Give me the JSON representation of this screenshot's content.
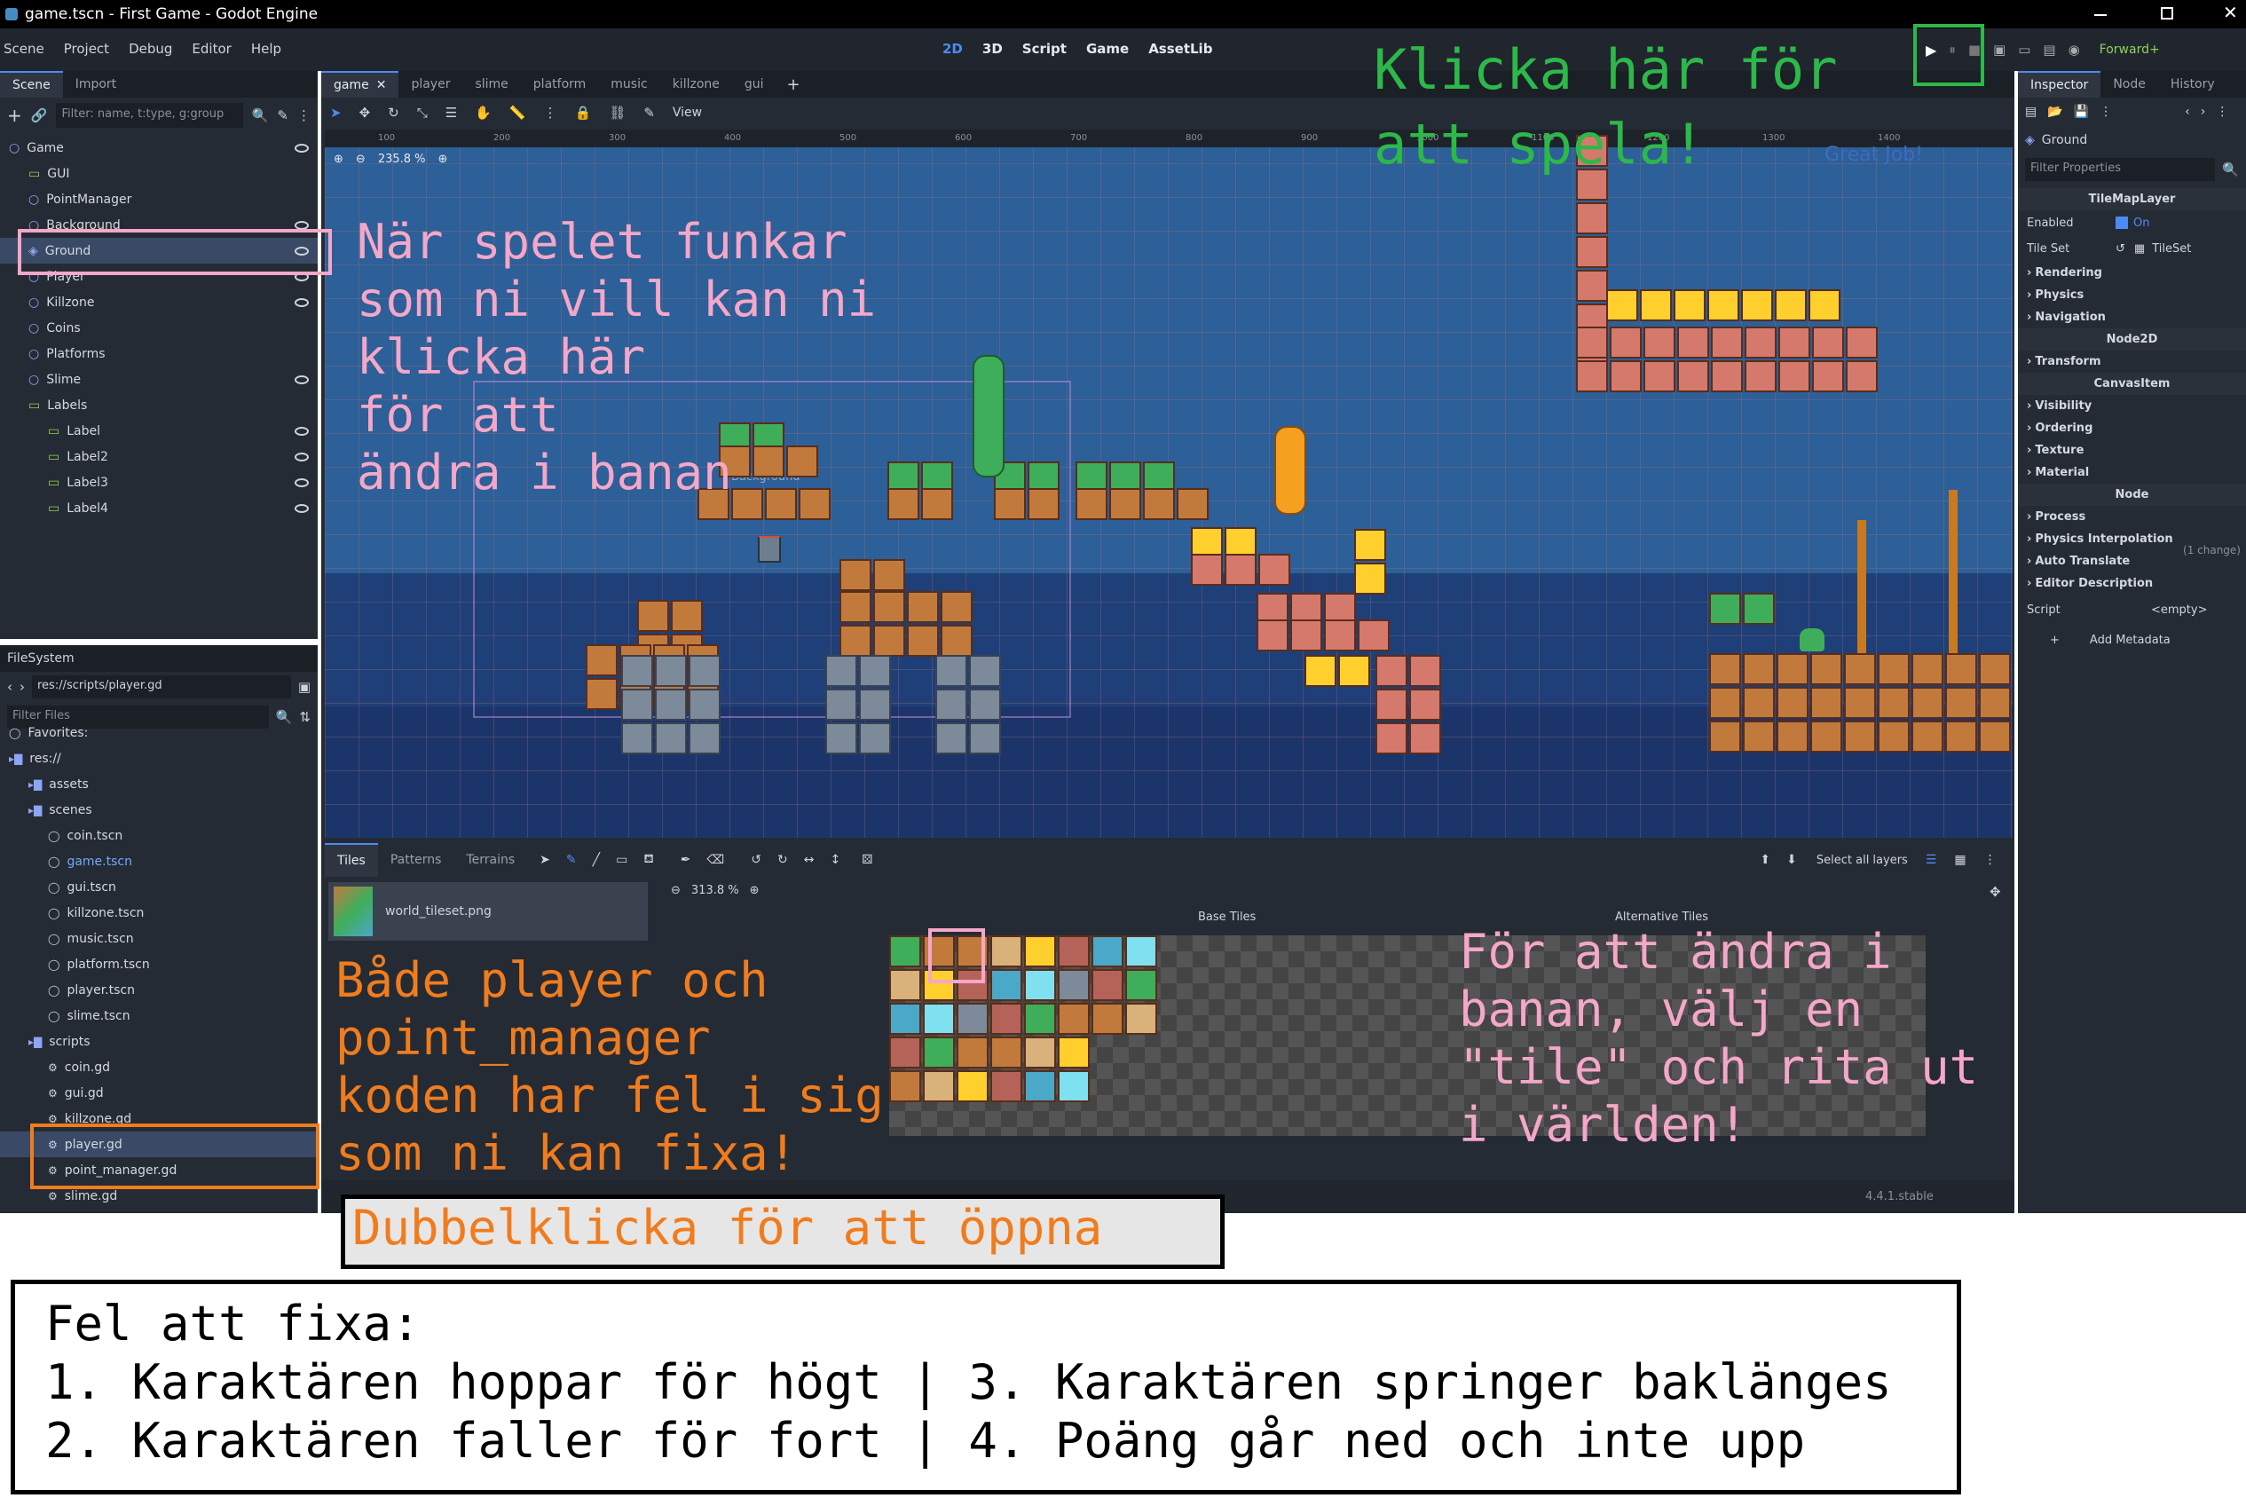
{
  "window": {
    "title": "game.tscn - First Game - Godot Engine"
  },
  "menu": {
    "items": [
      "Scene",
      "Project",
      "Debug",
      "Editor",
      "Help"
    ],
    "modes": [
      "2D",
      "3D",
      "Script",
      "Game",
      "AssetLib"
    ],
    "renderer": "Forward+"
  },
  "scene_dock": {
    "tabs": [
      "Scene",
      "Import"
    ],
    "filter_placeholder": "Filter: name, t:type, g:group",
    "nodes": [
      {
        "label": "Game",
        "indent": 0
      },
      {
        "label": "GUI",
        "indent": 1
      },
      {
        "label": "PointManager",
        "indent": 1
      },
      {
        "label": "Background",
        "indent": 1
      },
      {
        "label": "Ground",
        "indent": 1
      },
      {
        "label": "Player",
        "indent": 1
      },
      {
        "label": "Killzone",
        "indent": 1
      },
      {
        "label": "Coins",
        "indent": 1
      },
      {
        "label": "Platforms",
        "indent": 1
      },
      {
        "label": "Slime",
        "indent": 1
      },
      {
        "label": "Labels",
        "indent": 1
      },
      {
        "label": "Label",
        "indent": 2
      },
      {
        "label": "Label2",
        "indent": 2
      },
      {
        "label": "Label3",
        "indent": 2
      },
      {
        "label": "Label4",
        "indent": 2
      }
    ]
  },
  "filesystem": {
    "title": "FileSystem",
    "path": "res://scripts/player.gd",
    "filter_placeholder": "Filter Files",
    "items": [
      {
        "label": "Favorites:",
        "indent": 0
      },
      {
        "label": "res://",
        "indent": 0
      },
      {
        "label": "assets",
        "indent": 1
      },
      {
        "label": "scenes",
        "indent": 1
      },
      {
        "label": "coin.tscn",
        "indent": 2
      },
      {
        "label": "game.tscn",
        "indent": 2
      },
      {
        "label": "gui.tscn",
        "indent": 2
      },
      {
        "label": "killzone.tscn",
        "indent": 2
      },
      {
        "label": "music.tscn",
        "indent": 2
      },
      {
        "label": "platform.tscn",
        "indent": 2
      },
      {
        "label": "player.tscn",
        "indent": 2
      },
      {
        "label": "slime.tscn",
        "indent": 2
      },
      {
        "label": "scripts",
        "indent": 1
      },
      {
        "label": "coin.gd",
        "indent": 2
      },
      {
        "label": "gui.gd",
        "indent": 2
      },
      {
        "label": "killzone.gd",
        "indent": 2
      },
      {
        "label": "player.gd",
        "indent": 2
      },
      {
        "label": "point_manager.gd",
        "indent": 2
      },
      {
        "label": "slime.gd",
        "indent": 2
      }
    ]
  },
  "editor_tabs": [
    "game",
    "player",
    "slime",
    "platform",
    "music",
    "killzone",
    "gui"
  ],
  "viewport": {
    "view_label": "View",
    "zoom": "235.8 %",
    "background_label": "Background",
    "good_job": "Great Job!"
  },
  "ruler": [
    "100",
    "200",
    "300",
    "400",
    "500",
    "600",
    "700",
    "800",
    "900",
    "1000",
    "1100",
    "1200",
    "1300",
    "1400"
  ],
  "tilemap_panel": {
    "tabs": [
      "Tiles",
      "Patterns",
      "Terrains"
    ],
    "select_all_layers": "Select all layers",
    "zoom": "313.8 %",
    "tileset_file": "world_tileset.png",
    "base_tiles": "Base Tiles",
    "alt_tiles": "Alternative Tiles",
    "version": "4.4.1.stable"
  },
  "inspector": {
    "tabs": [
      "Inspector",
      "Node",
      "History"
    ],
    "node": "Ground",
    "filter_placeholder": "Filter Properties",
    "header": "TileMapLayer",
    "enabled_label": "Enabled",
    "enabled_value": "On",
    "tileset_label": "Tile Set",
    "tileset_value": "TileSet",
    "sections_a": [
      "Rendering",
      "Physics",
      "Navigation"
    ],
    "node2d": "Node2D",
    "sections_b": [
      "Transform"
    ],
    "canvasitem": "CanvasItem",
    "sections_c": [
      "Visibility",
      "Ordering",
      "Texture",
      "Material"
    ],
    "material_note": "(1 change)",
    "node_hdr": "Node",
    "sections_d": [
      "Process",
      "Physics Interpolation",
      "Auto Translate",
      "Editor Description"
    ],
    "script_label": "Script",
    "script_value": "<empty>",
    "add_metadata": "Add Metadata"
  },
  "annotations": {
    "play": [
      "Klicka här för",
      "att spela!"
    ],
    "edit": [
      "När spelet funkar",
      "som ni vill kan ni",
      "klicka här",
      "för att",
      "ändra i banan"
    ],
    "fix": [
      "Både player och",
      "point_manager",
      "koden har fel i sig",
      "som ni kan fixa!"
    ],
    "tiles": [
      "För att ändra i",
      "banan, välj en",
      "\"tile\" och rita ut",
      "i världen!"
    ],
    "dbl": "Dubbelklicka för att öppna",
    "bugs_title": "Fel att fixa:",
    "bugs": [
      "1. Karaktären hoppar för högt | 3. Karaktären springer baklänges",
      "2. Karaktären faller för fort | 4. Poäng går ned och inte upp"
    ]
  },
  "colors": {
    "green": "#2db84a",
    "pink": "#f4a7c8",
    "orange": "#f07c1e",
    "accent": "#4c8bf5"
  }
}
